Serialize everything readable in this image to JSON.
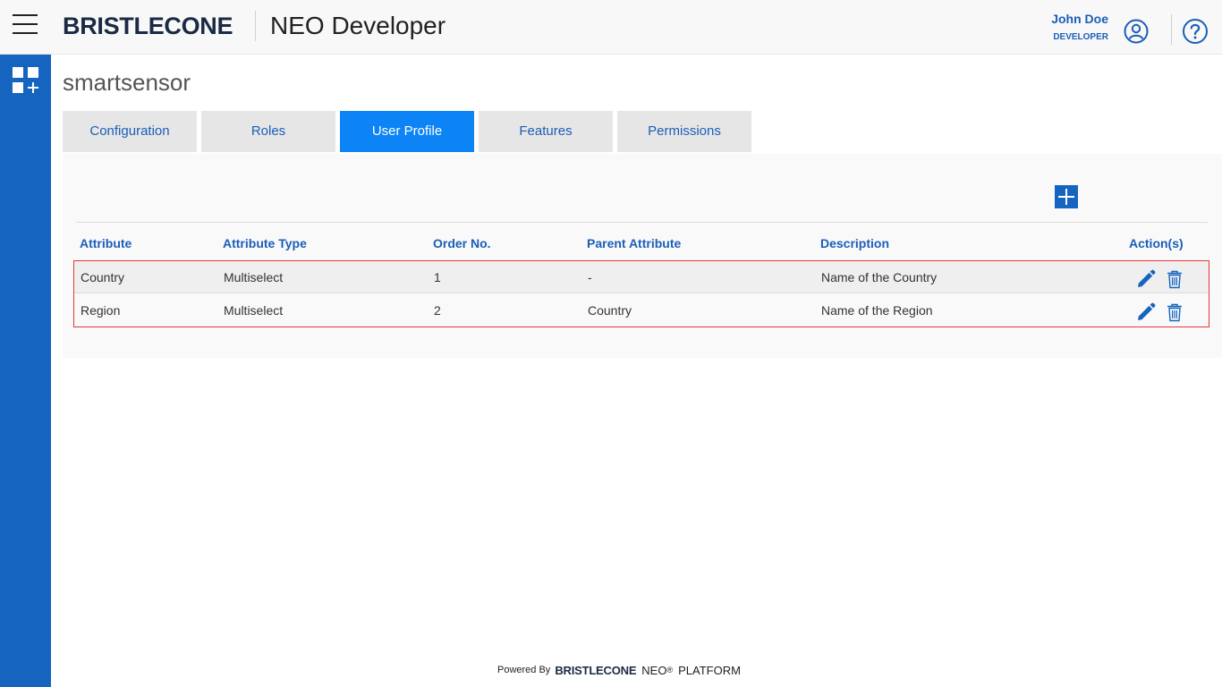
{
  "header": {
    "brand": "BRISTLECONE",
    "app_title": "NEO Developer",
    "user_name": "John Doe",
    "user_role": "DEVELOPER",
    "icons": [
      "menu-icon",
      "user-icon",
      "help-icon"
    ]
  },
  "sidebar": {
    "icon": "apps-add-icon"
  },
  "page": {
    "title": "smartsensor"
  },
  "tabs": [
    {
      "label": "Configuration",
      "active": false
    },
    {
      "label": "Roles",
      "active": false
    },
    {
      "label": "User Profile",
      "active": true
    },
    {
      "label": "Features",
      "active": false
    },
    {
      "label": "Permissions",
      "active": false
    }
  ],
  "table": {
    "headers": [
      "Attribute",
      "Attribute Type",
      "Order No.",
      "Parent Attribute",
      "Description",
      "Action(s)"
    ],
    "rows": [
      [
        "Country",
        "Multiselect",
        "1",
        "-",
        "Name of the Country"
      ],
      [
        "Region",
        "Multiselect",
        "2",
        "Country",
        "Name of the Region"
      ]
    ]
  },
  "footer": {
    "powered_by": "Powered By",
    "brand": "BRISTLECONE",
    "product": "NEO",
    "reg": "®",
    "platform": "PLATFORM"
  },
  "colors": {
    "primary": "#1565c0",
    "tab_active": "#0d84f5",
    "highlight_border": "#e53935"
  }
}
